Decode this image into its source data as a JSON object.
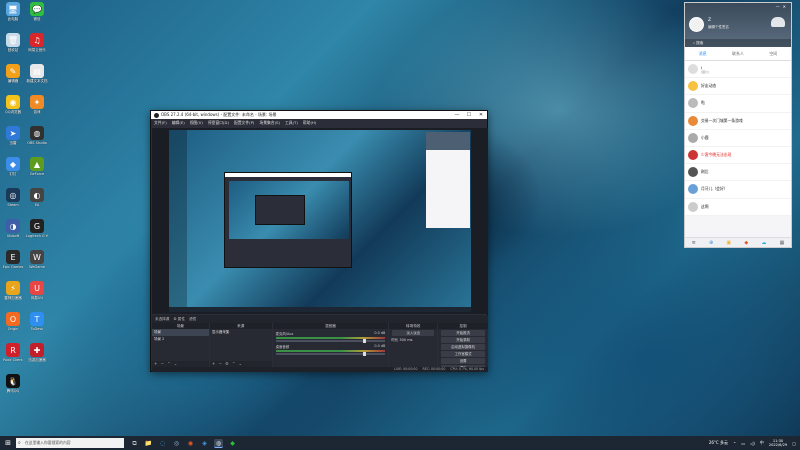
{
  "desktop": {
    "icons": [
      {
        "label": "此电脑",
        "glyph": "🖥",
        "color": "#5aa7e0"
      },
      {
        "label": "微信",
        "glyph": "💬",
        "color": "#2fbf3f"
      },
      {
        "label": "回收站",
        "glyph": "🗑",
        "color": "#c9dbe8"
      },
      {
        "label": "网易云音乐",
        "glyph": "♫",
        "color": "#d8262b"
      },
      {
        "label": "编辑器",
        "glyph": "✎",
        "color": "#f2a019"
      },
      {
        "label": "新建文本文档",
        "glyph": "▤",
        "color": "#e8e8e8"
      },
      {
        "label": "QQ浏览器",
        "glyph": "◉",
        "color": "#f3c21b"
      },
      {
        "label": "游戏",
        "glyph": "✦",
        "color": "#f08a24"
      },
      {
        "label": "迅雷",
        "glyph": "➤",
        "color": "#2f7ad8"
      },
      {
        "label": "OBS Studio",
        "glyph": "◍",
        "color": "#303030"
      },
      {
        "label": "钉钉",
        "glyph": "◆",
        "color": "#3b8de8"
      },
      {
        "label": "GeForce",
        "glyph": "▲",
        "color": "#5e9c1f"
      },
      {
        "label": "Steam",
        "glyph": "◎",
        "color": "#1b3a5a"
      },
      {
        "label": "EA",
        "glyph": "◐",
        "color": "#444"
      },
      {
        "label": "Ubisoft",
        "glyph": "◑",
        "color": "#3d5fa8"
      },
      {
        "label": "Logitech G HUB",
        "glyph": "G",
        "color": "#222"
      },
      {
        "label": "Epic Games",
        "glyph": "E",
        "color": "#2a2a2a"
      },
      {
        "label": "WeGame",
        "glyph": "W",
        "color": "#444"
      },
      {
        "label": "雷神加速器",
        "glyph": "⚡",
        "color": "#e8a41a"
      },
      {
        "label": "网易UU",
        "glyph": "U",
        "color": "#e84545"
      },
      {
        "label": "Origin",
        "glyph": "O",
        "color": "#f36a20"
      },
      {
        "label": "ToDesk",
        "glyph": "T",
        "color": "#2e8ff0"
      },
      {
        "label": "Rock Client",
        "glyph": "R",
        "color": "#d0202a"
      },
      {
        "label": "迅游加速器",
        "glyph": "✚",
        "color": "#c21f2b"
      },
      {
        "label": "腾讯QQ",
        "glyph": "🐧",
        "color": "#111"
      }
    ]
  },
  "obs": {
    "title": "OBS 27.2.4 (64-bit, windows) - 配置文件: 未命名 - 场景: 场景",
    "menu": [
      "文件(F)",
      "编辑(E)",
      "视图(V)",
      "停靠窗口(D)",
      "配置文件(P)",
      "场景集合(S)",
      "工具(T)",
      "帮助(H)"
    ],
    "source_bar": {
      "label": "未选择源",
      "props": "⚙ 属性",
      "filters": "滤镜"
    },
    "docks": {
      "scenes": {
        "header": "场景",
        "items": [
          "场景",
          "场景 2"
        ]
      },
      "sources": {
        "header": "来源",
        "items": [
          "显示器采集"
        ]
      },
      "mixer": {
        "header": "混音器",
        "channels": [
          {
            "name": "麦克风/Aux",
            "db": "0.0 dB"
          },
          {
            "name": "桌面音频",
            "db": "0.0 dB"
          }
        ]
      },
      "transitions": {
        "header": "转场特效",
        "type": "淡入淡出",
        "duration_label": "时长",
        "duration": "300 ms"
      },
      "controls": {
        "header": "控制",
        "buttons": [
          "开始推流",
          "开始录制",
          "启动虚拟摄像机",
          "工作室模式",
          "设置",
          "退出"
        ]
      }
    },
    "status": {
      "live": "LIVE: 00:00:00",
      "rec": "REC: 00:00:00",
      "cpu": "CPU: 0.7%, 60.00 fps"
    }
  },
  "qq": {
    "nickname": "Z",
    "signature": "编辑个性签名",
    "search_placeholder": "搜索",
    "tabs": [
      "消息",
      "联系人",
      "空间"
    ],
    "contacts": [
      {
        "name": "J",
        "msg": "[图片]",
        "time": "",
        "color": "#ddd",
        "highlight": false
      },
      {
        "name": "好友动态",
        "msg": "",
        "time": "",
        "color": "#f5c242",
        "highlight": false
      },
      {
        "name": "啦",
        "msg": "",
        "time": "",
        "color": "#bbb",
        "highlight": false
      },
      {
        "name": "交易一次门城第一条游戏",
        "msg": "",
        "time": "",
        "color": "#e88a3a",
        "highlight": false
      },
      {
        "name": "小鹿",
        "msg": "",
        "time": "",
        "color": "#aaa",
        "highlight": false
      },
      {
        "name": "少客今晚无法出现",
        "msg": "",
        "time": "",
        "color": "#c33",
        "highlight": true
      },
      {
        "name": "刷后",
        "msg": "",
        "time": "",
        "color": "#555",
        "highlight": false
      },
      {
        "name": "月牙儿（会好）",
        "msg": "",
        "time": "",
        "color": "#6aa0d8",
        "highlight": false
      },
      {
        "name": "这啊",
        "msg": "",
        "time": "",
        "color": "#ccc",
        "highlight": false
      }
    ]
  },
  "taskbar": {
    "search_placeholder": "在这里输入你要搜索的内容",
    "apps": [
      {
        "name": "task-view",
        "glyph": "⧉",
        "color": "#ccc"
      },
      {
        "name": "file-explorer",
        "glyph": "📁",
        "color": "#f5c542"
      },
      {
        "name": "edge",
        "glyph": "◌",
        "color": "#3ab0e8"
      },
      {
        "name": "steam",
        "glyph": "◎",
        "color": "#9cb8d8"
      },
      {
        "name": "browser",
        "glyph": "◉",
        "color": "#e85a2a"
      },
      {
        "name": "qq",
        "glyph": "◈",
        "color": "#4aa0e8"
      },
      {
        "name": "obs",
        "glyph": "◍",
        "color": "#ddd",
        "active": true
      },
      {
        "name": "wechat",
        "glyph": "◆",
        "color": "#2fbf3f"
      }
    ],
    "weather": "26°C 多云",
    "time": "11:30",
    "date": "2022/6/29",
    "lang": "中"
  }
}
